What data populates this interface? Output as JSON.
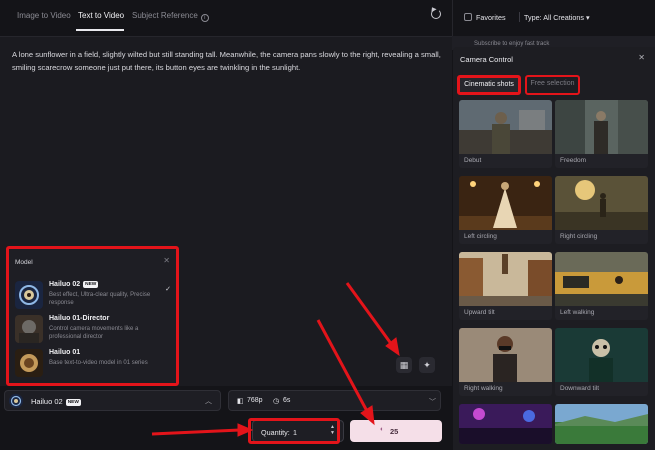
{
  "tabs": [
    {
      "label": "Image to Video",
      "active": false
    },
    {
      "label": "Text to Video",
      "active": true
    },
    {
      "label": "Subject Reference",
      "active": false,
      "icon": "info-icon"
    }
  ],
  "prompt": {
    "text": "A lone sunflower in a field, slightly wilted but still standing tall. Meanwhile, the camera pans slowly to the right, revealing a small, smiling scarecrow someone just put there, its button eyes are twinkling in the sunlight."
  },
  "model_panel": {
    "title": "Model",
    "close_icon": "close-icon",
    "items": [
      {
        "name": "Hailuo 02",
        "badge": "NEW",
        "desc": "Best effect, Ultra-clear quality, Precise response",
        "selected": true
      },
      {
        "name": "Hailuo 01-Director",
        "badge": "",
        "desc": "Control camera movements like a professional director",
        "selected": false
      },
      {
        "name": "Hailuo 01",
        "badge": "",
        "desc": "Base text-to-video model in 01 series",
        "selected": false
      }
    ]
  },
  "model_select": {
    "label": "Hailuo 02",
    "badge": "NEW"
  },
  "settings": {
    "resolution": "768p",
    "duration": "6s"
  },
  "quantity": {
    "label": "Quantity:",
    "value": "1"
  },
  "generate": {
    "cost": "25"
  },
  "right_header": {
    "favorites_label": "Favorites",
    "type_label": "Type:",
    "type_value": "All Creations"
  },
  "behind_text": "Subscribe to enjoy fast track",
  "camera_control": {
    "title": "Camera Control",
    "tabs": [
      {
        "label": "Cinematic shots",
        "active": true
      },
      {
        "label": "Free selection",
        "active": false
      }
    ],
    "shots": [
      {
        "name": "Debut"
      },
      {
        "name": "Freedom"
      },
      {
        "name": "Left circling"
      },
      {
        "name": "Right circling"
      },
      {
        "name": "Upward tilt"
      },
      {
        "name": "Left walking"
      },
      {
        "name": "Right walking"
      },
      {
        "name": "Downward tilt"
      },
      {
        "name": ""
      },
      {
        "name": ""
      }
    ]
  },
  "colors": {
    "accent": "#e3141a",
    "generate_bg": "#f5dfe8",
    "panel_bg": "#1d1d22"
  }
}
